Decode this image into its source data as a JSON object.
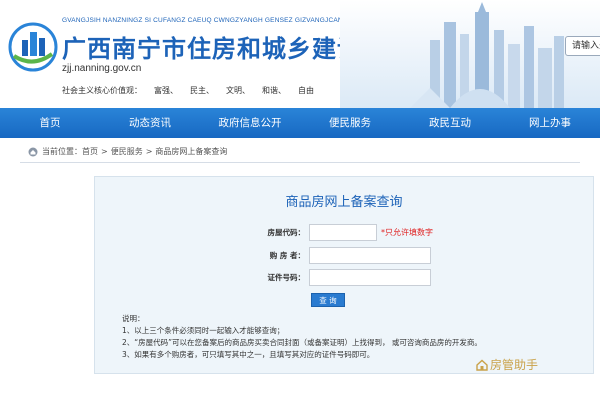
{
  "header": {
    "pinyin": "GVANGJSIH NANZNINGZ SI CUFANGZ CAEUQ CWNGZYANGH GENSEZ GIZVANGJCAN",
    "title": "广西南宁市住房和城乡建设局网站",
    "domain": "zjj.nanning.gov.cn",
    "core_values_label": "社会主义核心价值观：",
    "core_values": [
      "富强、",
      "民主、",
      "文明、",
      "和谐、",
      "自由"
    ],
    "login_label": "请输入关键"
  },
  "nav": {
    "items": [
      "首页",
      "动态资讯",
      "政府信息公开",
      "便民服务",
      "政民互动",
      "网上办事"
    ]
  },
  "breadcrumb": {
    "prefix": "当前位置：",
    "items": [
      "首页",
      "便民服务",
      "商品房网上备案查询"
    ],
    "separator": ">"
  },
  "form": {
    "title": "商品房网上备案查询",
    "house_code_label": "房屋代码：",
    "house_code_value": "",
    "house_code_hint": "*只允许填数字",
    "buyer_label": "购 房 者：",
    "buyer_value": "",
    "id_label": "证件号码：",
    "id_value": "",
    "search_label": "查 询"
  },
  "notes": {
    "heading": "说明：",
    "items": [
      "1、以上三个条件必须同时一起输入才能够查询；",
      "2、“房屋代码”可以在您备案后的商品房买卖合同封面（或备案证明）上找得到，  或可咨询商品房的开发商。",
      "3、如果有多个购房者，可只填写其中之一，且填写其对应的证件号码即可。"
    ]
  },
  "watermark": {
    "text": "房管助手"
  },
  "colors": {
    "brand": "#1d63b8",
    "nav": "#1d72c9",
    "panel": "#eef5fa",
    "hint": "#e02020"
  }
}
